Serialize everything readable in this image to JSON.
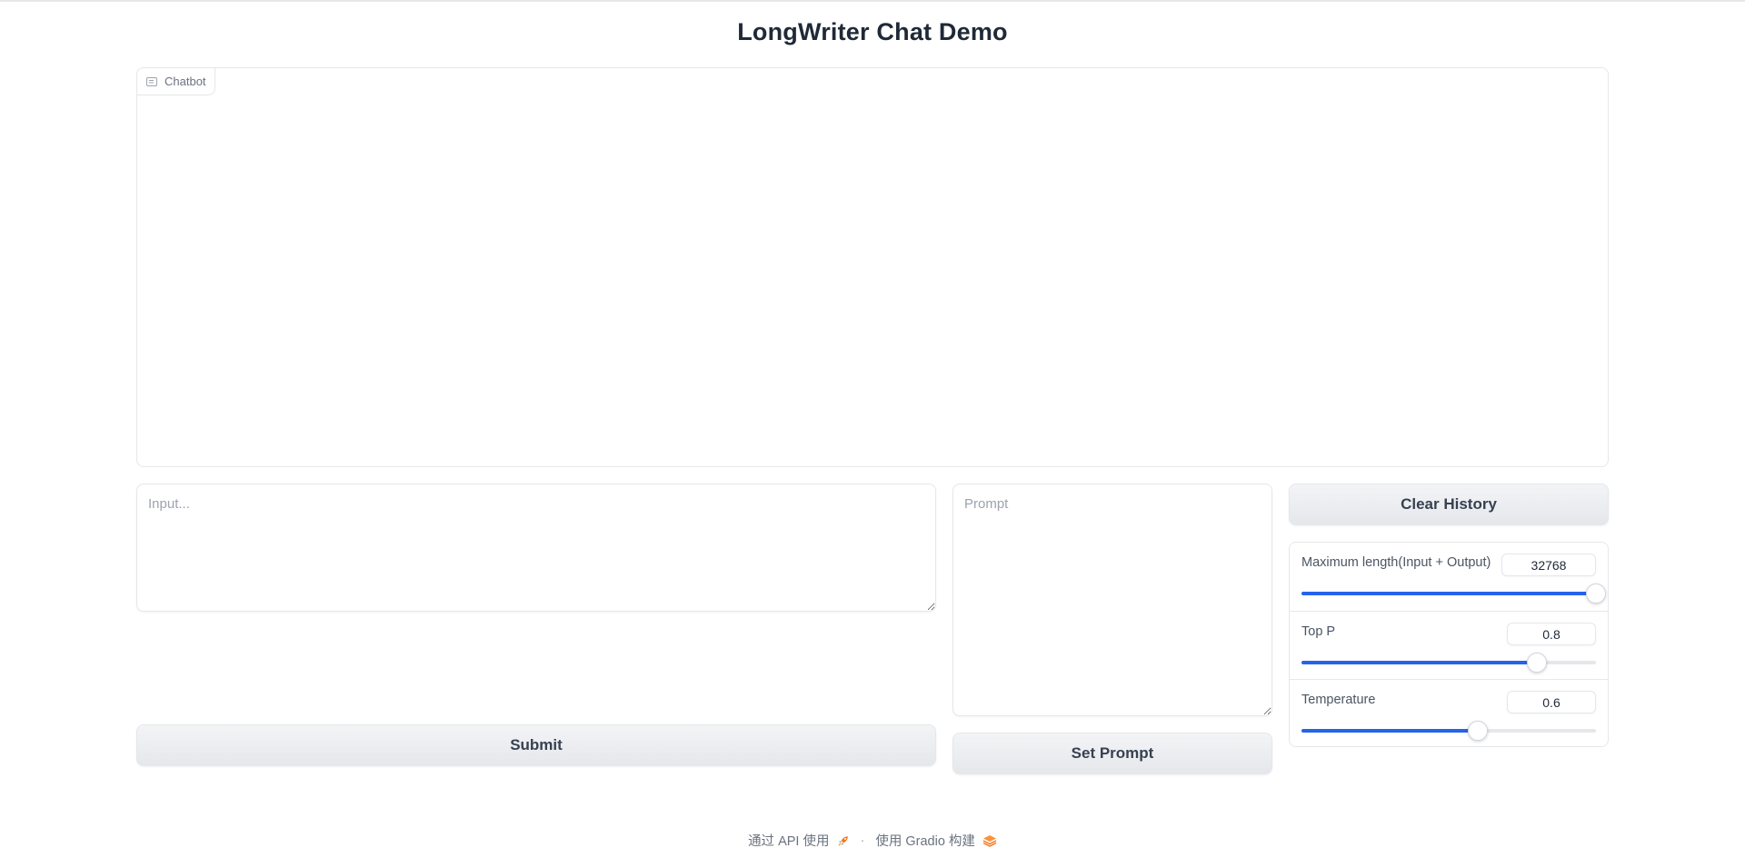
{
  "header": {
    "title": "LongWriter Chat Demo"
  },
  "chatbot": {
    "label": "Chatbot",
    "icon": "chat-bubble-icon"
  },
  "input": {
    "placeholder": "Input...",
    "value": ""
  },
  "prompt": {
    "placeholder": "Prompt",
    "value": ""
  },
  "buttons": {
    "submit": "Submit",
    "set_prompt": "Set Prompt",
    "clear_history": "Clear History"
  },
  "sliders": [
    {
      "label": "Maximum length(Input + Output)",
      "value": "32768",
      "fraction": 1.0
    },
    {
      "label": "Top P",
      "value": "0.8",
      "fraction": 0.8
    },
    {
      "label": "Temperature",
      "value": "0.6",
      "fraction": 0.6
    }
  ],
  "footer": {
    "api_text": "通过 API 使用",
    "api_icon": "rocket-icon",
    "separator": "·",
    "built_text": "使用 Gradio 构建",
    "built_icon": "gradio-logo-icon"
  },
  "colors": {
    "accent": "#2563eb",
    "border": "#e5e7eb",
    "button_bg": "#f3f4f6",
    "text": "#1f2937",
    "muted": "#6b7280",
    "gradio_orange": "#f97316"
  }
}
